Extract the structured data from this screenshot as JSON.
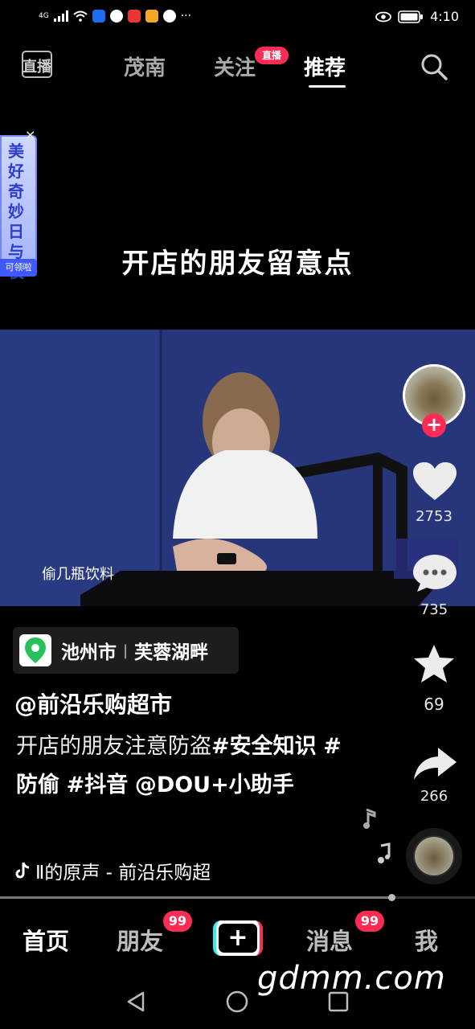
{
  "status_bar": {
    "signal_label": "4G",
    "time": "4:10",
    "icons": [
      "signal-icon",
      "wifi-icon",
      "shield-app-icon",
      "browser-app-icon",
      "news-app-icon",
      "video-app-icon",
      "hand-app-icon",
      "more-icon",
      "eye-icon",
      "battery-icon"
    ]
  },
  "top_nav": {
    "logo_label": "直播",
    "tabs": [
      {
        "label": "茂南"
      },
      {
        "label": "关注",
        "badge": "直播"
      },
      {
        "label": "推荐",
        "active": true
      }
    ],
    "search_icon": "search-icon"
  },
  "video": {
    "headline": "开店的朋友留意点",
    "subtitle": "偷几瓶饮料",
    "promo": {
      "text": "美好奇妙日与夜",
      "button": "可领啦",
      "close": "×"
    }
  },
  "rail": {
    "likes": "2753",
    "comments": "735",
    "favorites": "69",
    "shares": "266",
    "follow": "+"
  },
  "post": {
    "location_city": "池州市",
    "location_place": "芙蓉湖畔",
    "author": "@前沿乐购超市",
    "desc_plain": "开店的朋友注意防盗",
    "desc_tag1": "#安全知识",
    "desc_tag2": "#防偷",
    "desc_tag3": "#抖音",
    "desc_mention": "@DOU+小助手",
    "music": "Ⅱ的原声 - 前沿乐购超"
  },
  "bottom_tabs": {
    "home": "首页",
    "friends": "朋友",
    "friends_badge": "99",
    "create": "+",
    "messages": "消息",
    "messages_badge": "99",
    "me": "我"
  },
  "watermark": "gdmm.com",
  "colors": {
    "accent": "#fe2c55",
    "teal": "#25f4ee",
    "location_green": "#25c25c"
  }
}
